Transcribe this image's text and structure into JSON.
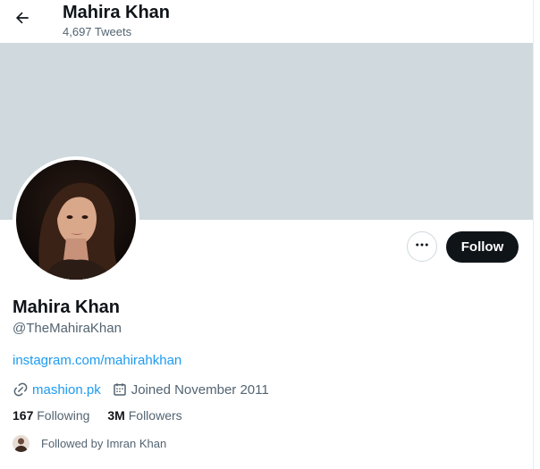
{
  "header": {
    "title": "Mahira Khan",
    "subtitle": "4,697 Tweets"
  },
  "actions": {
    "follow_label": "Follow"
  },
  "profile": {
    "name": "Mahira Khan",
    "handle": "@TheMahiraKhan",
    "bio_link": "instagram.com/mahirahkhan",
    "website": "mashion.pk",
    "joined": "Joined November 2011",
    "following_count": "167",
    "following_label": "Following",
    "followers_count": "3M",
    "followers_label": "Followers",
    "followed_by": "Followed by Imran Khan"
  },
  "icons": {
    "back": "arrow-left-icon",
    "more": "more-options-icon",
    "link": "link-icon",
    "calendar": "calendar-icon"
  },
  "colors": {
    "accent": "#1d9bf0",
    "banner": "#cfd9de",
    "follow_button": "#0f1419",
    "secondary_text": "#536471"
  }
}
